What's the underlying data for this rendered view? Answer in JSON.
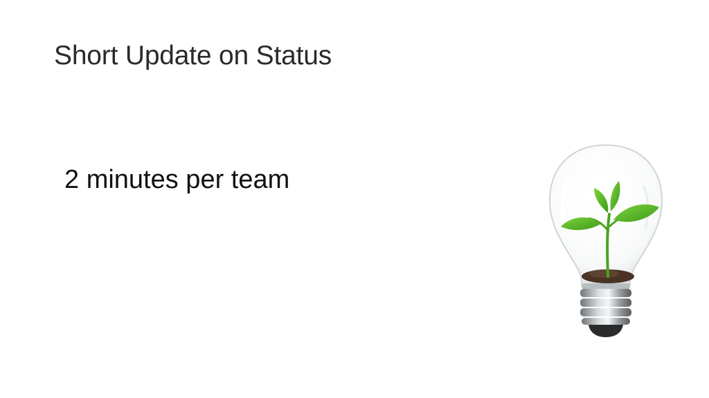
{
  "slide": {
    "title": "Short Update on Status",
    "body": "2 minutes per team"
  },
  "image": {
    "icon": "lightbulb-with-sprout-icon",
    "colors": {
      "leaf": "#5cb82e",
      "leaf_dark": "#3f8f1c",
      "soil": "#4a3324",
      "metal": "#9aa0a3"
    }
  }
}
